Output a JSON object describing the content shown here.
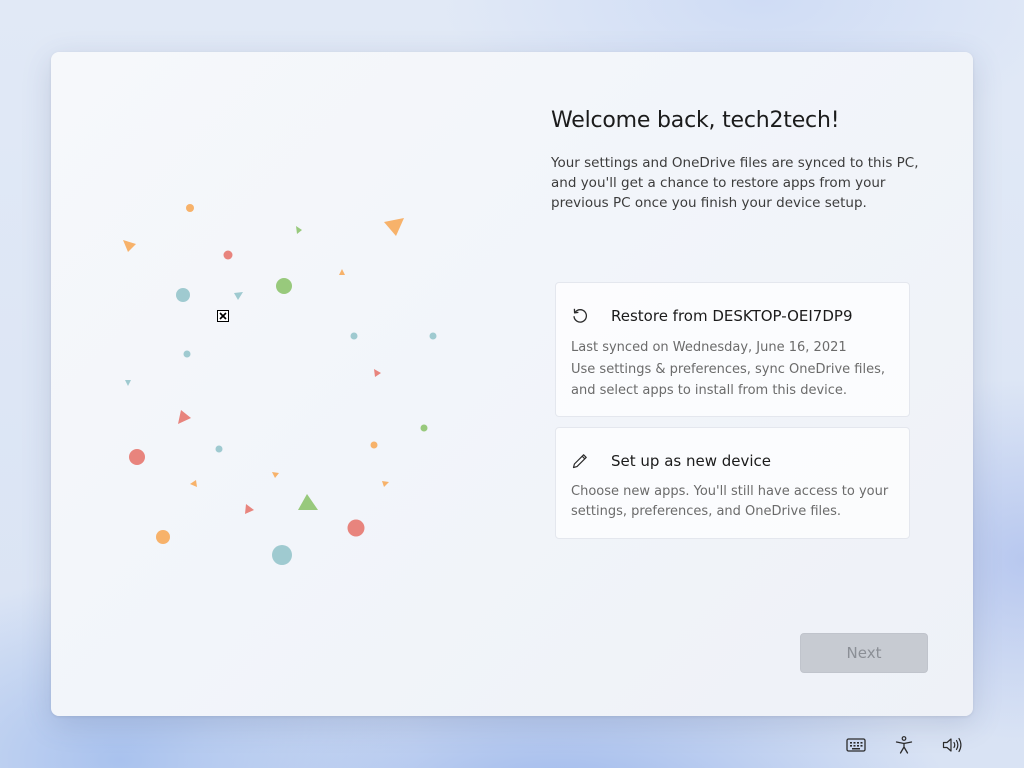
{
  "header": {
    "title": "Welcome back, tech2tech!",
    "description": "Your settings and OneDrive files are synced to this PC, and you'll get a chance to restore apps from your previous PC once you finish your device setup."
  },
  "options": {
    "restore": {
      "icon": "restore-icon",
      "title": "Restore from DESKTOP-OEI7DP9",
      "last_synced": "Last synced on Wednesday, June 16, 2021",
      "details": "Use settings & preferences, sync OneDrive files, and select apps to install from this device."
    },
    "new_device": {
      "icon": "pencil-icon",
      "title": "Set up as new device",
      "details": "Choose new apps. You'll still have access to your settings, preferences, and OneDrive files."
    }
  },
  "footer": {
    "next_label": "Next"
  },
  "tray": {
    "icons": [
      "keyboard-icon",
      "accessibility-icon",
      "volume-icon"
    ]
  },
  "colors": {
    "confetti_orange": "#f7b26a",
    "confetti_red": "#e8847d",
    "confetti_teal": "#9fcad0",
    "confetti_green": "#98c97c",
    "next_disabled_bg": "#c7cbd2",
    "next_disabled_text": "#8b8f96"
  }
}
